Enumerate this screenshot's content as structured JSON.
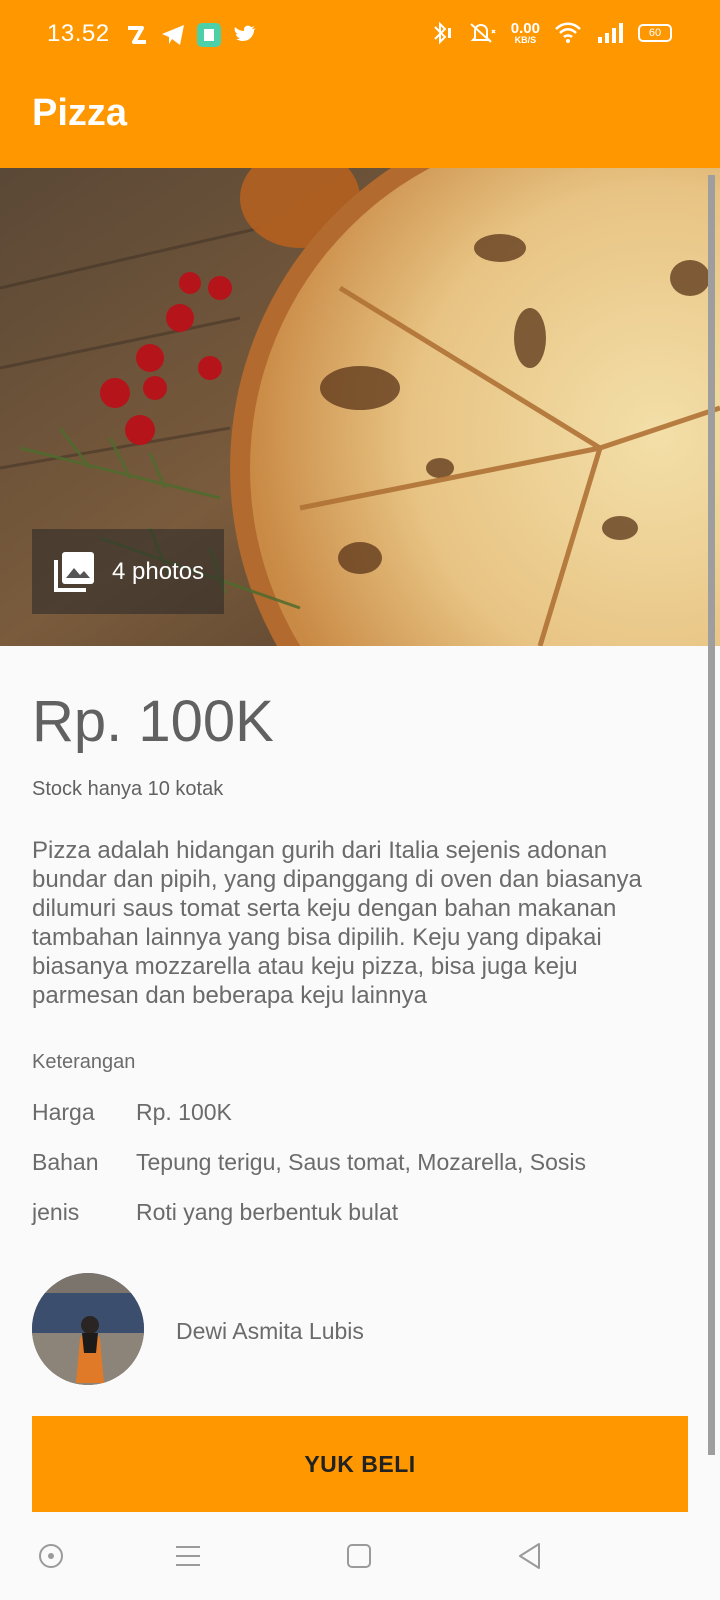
{
  "status_bar": {
    "time": "13.52",
    "net_speed_value": "0.00",
    "net_speed_unit": "KB/S",
    "battery": "60",
    "left_icons": [
      "sync-icon",
      "telegram-icon",
      "app-icon",
      "twitter-icon"
    ],
    "right_icons": [
      "bluetooth-icon",
      "mute-icon",
      "net-speed",
      "wifi-icon",
      "signal-icon",
      "battery-icon"
    ]
  },
  "appbar": {
    "title": "Pizza",
    "color": "#ff9800"
  },
  "gallery": {
    "photos_label": "4 photos"
  },
  "product": {
    "price": "Rp. 100K",
    "stock": "Stock hanya 10 kotak",
    "description": "Pizza adalah hidangan gurih dari Italia sejenis adonan bundar dan pipih, yang dipanggang di oven dan biasanya dilumuri saus tomat serta keju dengan bahan makanan tambahan lainnya yang bisa dipilih. Keju yang dipakai biasanya mozzarella atau keju pizza, bisa juga keju parmesan dan beberapa keju lainnya"
  },
  "details": {
    "heading": "Keterangan",
    "rows": [
      {
        "key": "Harga",
        "value": "Rp. 100K"
      },
      {
        "key": "Bahan",
        "value": "Tepung terigu, Saus tomat, Mozarella, Sosis"
      },
      {
        "key": "jenis",
        "value": "Roti yang berbentuk bulat"
      }
    ]
  },
  "seller": {
    "name": "Dewi Asmita Lubis"
  },
  "buy_button": {
    "label": "YUK BELI"
  },
  "nav": {
    "icons": [
      "home-circle-icon",
      "menu-icon",
      "square-icon",
      "back-triangle-icon"
    ]
  }
}
